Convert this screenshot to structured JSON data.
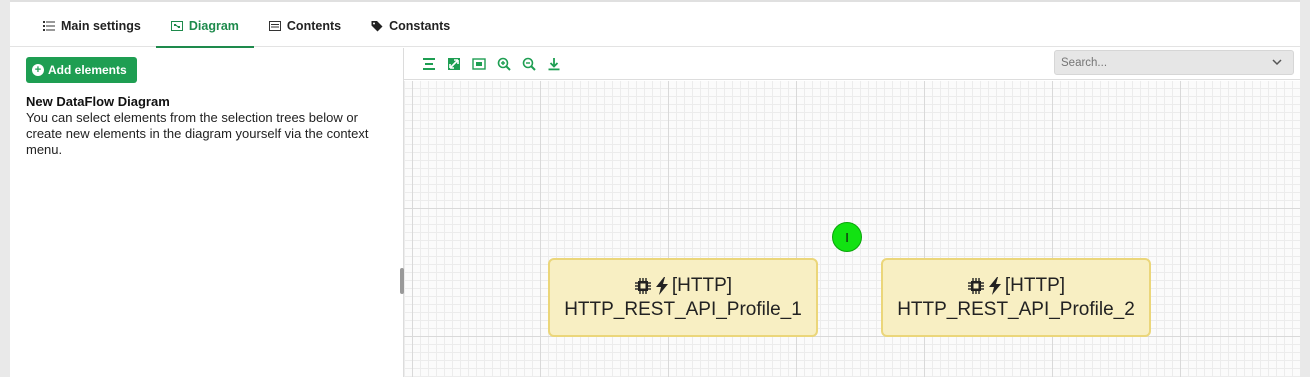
{
  "tabs": [
    {
      "label": "Main settings",
      "icon": "list-icon"
    },
    {
      "label": "Diagram",
      "icon": "diagram-icon"
    },
    {
      "label": "Contents",
      "icon": "contents-icon"
    },
    {
      "label": "Constants",
      "icon": "tag-icon"
    }
  ],
  "active_tab": "Diagram",
  "left": {
    "add_button": "Add elements",
    "title": "New DataFlow Diagram",
    "description": "You can select elements from the selection trees below or create new elements in the diagram yourself via the context menu."
  },
  "toolbar": {
    "buttons": [
      "align-icon",
      "fit-icon",
      "image-icon",
      "zoom-in-icon",
      "zoom-out-icon",
      "download-icon"
    ],
    "search_placeholder": "Search..."
  },
  "nodes": [
    {
      "type": "[HTTP]",
      "name": "HTTP_REST_API_Profile_1"
    },
    {
      "type": "[HTTP]",
      "name": "HTTP_REST_API_Profile_2"
    }
  ],
  "marker": {
    "label": "I"
  },
  "colors": {
    "accent": "#1e8a4c",
    "button": "#1e9e52",
    "node_fill": "#f8efc3",
    "node_border": "#ebd67a",
    "marker": "#12e212"
  }
}
